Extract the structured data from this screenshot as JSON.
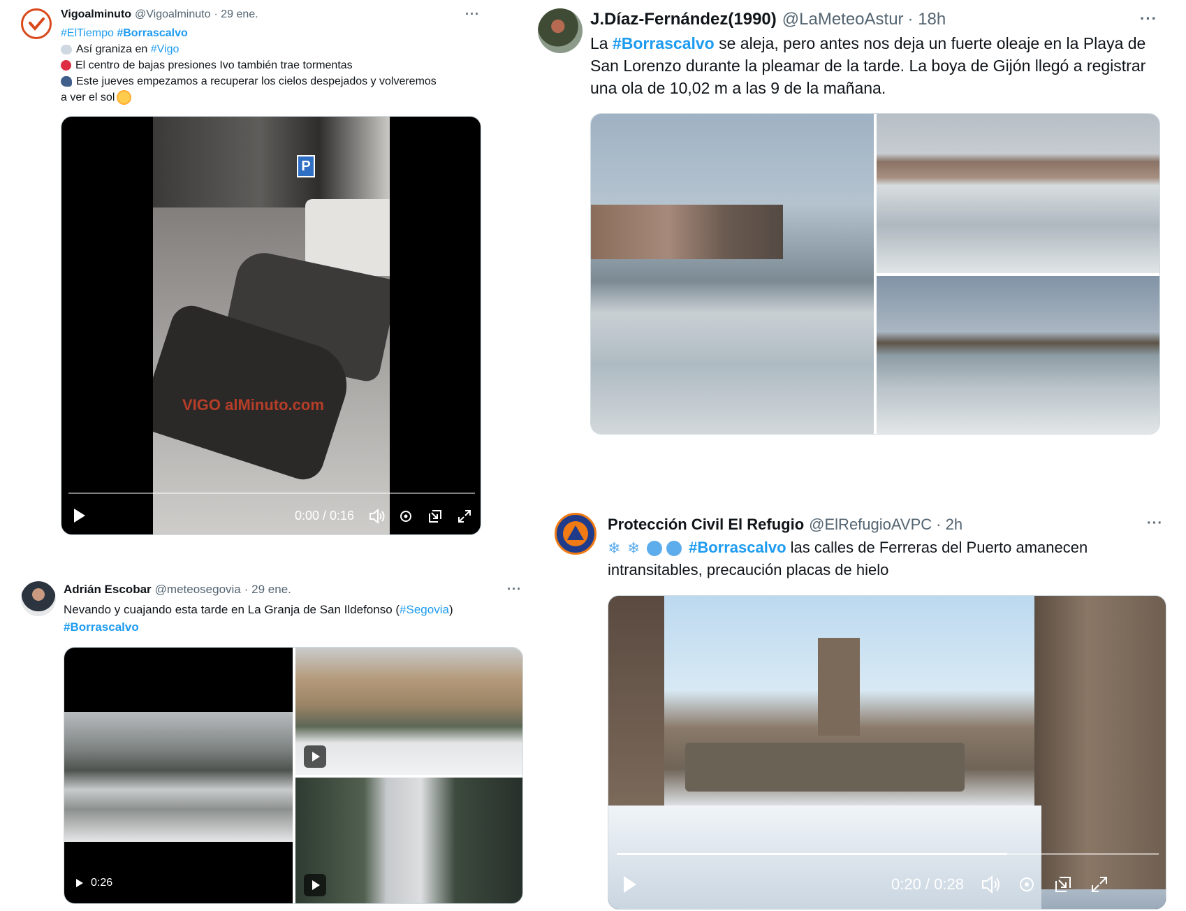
{
  "tweets": [
    {
      "name": "Vigoalminuto",
      "handle": "@Vigoalminuto",
      "date": "· 29 ene.",
      "line1": [
        "#ElTiempo",
        "#Borrascalvo"
      ],
      "line2_pre": "Así graniza en ",
      "line2_tag": "#Vigo",
      "line3": "El centro de bajas presiones Ivo también trae tormentas",
      "line4": "Este jueves empezamos a recuperar los cielos despejados y volveremos",
      "line5": "a ver el sol",
      "video_time": "0:00 / 0:16",
      "watermark": "VIGO alMinuto.com"
    },
    {
      "name": "J.Díaz-Fernández(1990)",
      "handle": "@LaMeteoAstur",
      "date": "· 18h",
      "pre": "La ",
      "tag": "#Borrascalvo",
      "post": " se aleja, pero antes nos deja un fuerte oleaje en la Playa de San Lorenzo durante la pleamar de la tarde. La boya de Gijón llegó a registrar una ola de 10,02 m a las 9 de la mañana."
    },
    {
      "name": "Adrián Escobar",
      "handle": "@meteosegovia",
      "date": "· 29 ene.",
      "text_pre": "Nevando y cuajando esta tarde en La Granja de San Ildefonso (",
      "text_tag": "#Segovia",
      "text_post": ")",
      "tag2": "#Borrascalvo",
      "video_duration": "0:26"
    },
    {
      "name": "Protección Civil El Refugio",
      "handle": "@ElRefugioAVPC",
      "date": "· 2h",
      "tag": "#Borrascalvo",
      "text1": " las calles de Ferreras del Puerto amanecen",
      "text2": "intransitables, precaución placas de hielo",
      "video_time": "0:20 / 0:28",
      "video_progress": 0.72
    }
  ],
  "more_label": "···",
  "colors": {
    "link": "#1d9bf0",
    "muted": "#536471",
    "border": "#cfd9de"
  }
}
